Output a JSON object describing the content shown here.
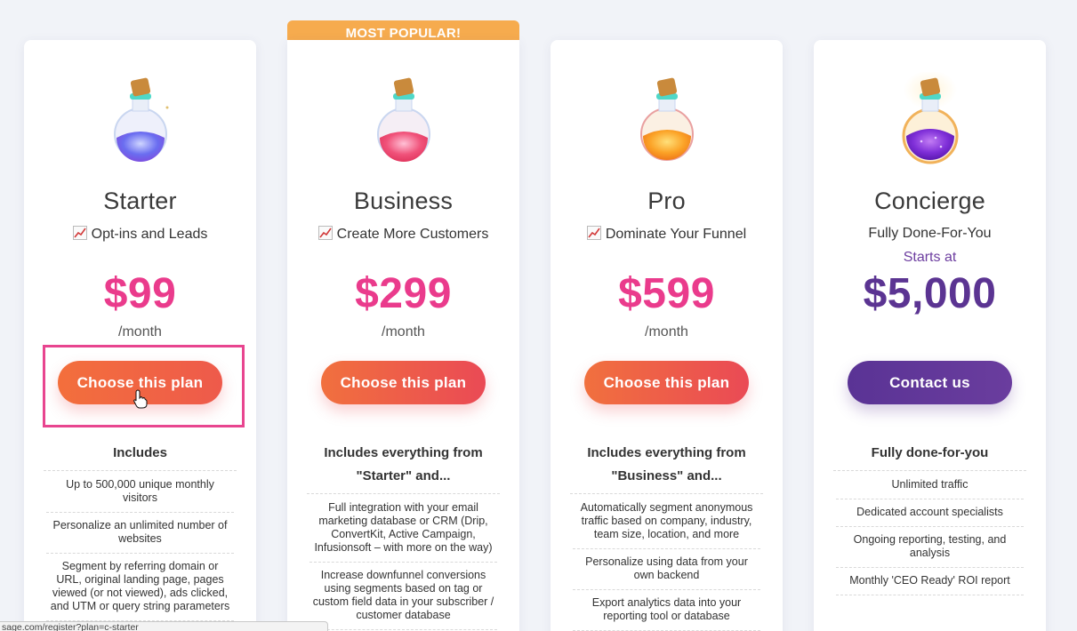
{
  "popular_banner": "MOST POPULAR!",
  "plans": [
    {
      "name": "Starter",
      "tagline": "Opt-ins and Leads",
      "price": "$99",
      "period": "/month",
      "cta": "Choose this plan",
      "includes_title": "Includes",
      "features": [
        "Up to 500,000 unique monthly visitors",
        "Personalize an unlimited number of websites",
        "Segment by referring domain or URL, original landing page, pages viewed (or not viewed), ads clicked, and UTM or query string parameters"
      ]
    },
    {
      "name": "Business",
      "tagline": "Create More Customers",
      "price": "$299",
      "period": "/month",
      "cta": "Choose this plan",
      "includes_title": "Includes everything from \"Starter\" and...",
      "features": [
        "Full integration with your email marketing database or CRM (Drip, ConvertKit, Active Campaign, Infusionsoft – with more on the way)",
        "Increase downfunnel conversions using segments based on tag or custom field data in your subscriber / customer database"
      ]
    },
    {
      "name": "Pro",
      "tagline": "Dominate Your Funnel",
      "price": "$599",
      "period": "/month",
      "cta": "Choose this plan",
      "includes_title": "Includes everything from \"Business\" and...",
      "features": [
        "Automatically segment anonymous traffic based on company, industry, team size, location, and more",
        "Personalize using data from your own backend",
        "Export analytics data into your reporting tool or database"
      ]
    },
    {
      "name": "Concierge",
      "tagline": "Fully Done-For-You",
      "starts_at": "Starts at",
      "price": "$5,000",
      "cta": "Contact us",
      "includes_title": "Fully done-for-you",
      "features": [
        "Unlimited traffic",
        "Dedicated account specialists",
        "Ongoing reporting, testing, and analysis",
        "Monthly 'CEO Ready' ROI report"
      ]
    }
  ],
  "status_url": "sage.com/register?plan=c-starter",
  "colors": {
    "price_pink": "#ea3b8c",
    "cta_orange": "#f1703e",
    "cta_red": "#ea4a55",
    "concierge_purple": "#5b3492",
    "popular_orange": "#f6ab4e",
    "highlight_pink": "#e8458f"
  },
  "icons": {
    "tagline": "chart-increasing-icon",
    "potions": [
      "blue-potion-icon",
      "pink-potion-icon",
      "orange-potion-icon",
      "purple-potion-icon"
    ]
  }
}
